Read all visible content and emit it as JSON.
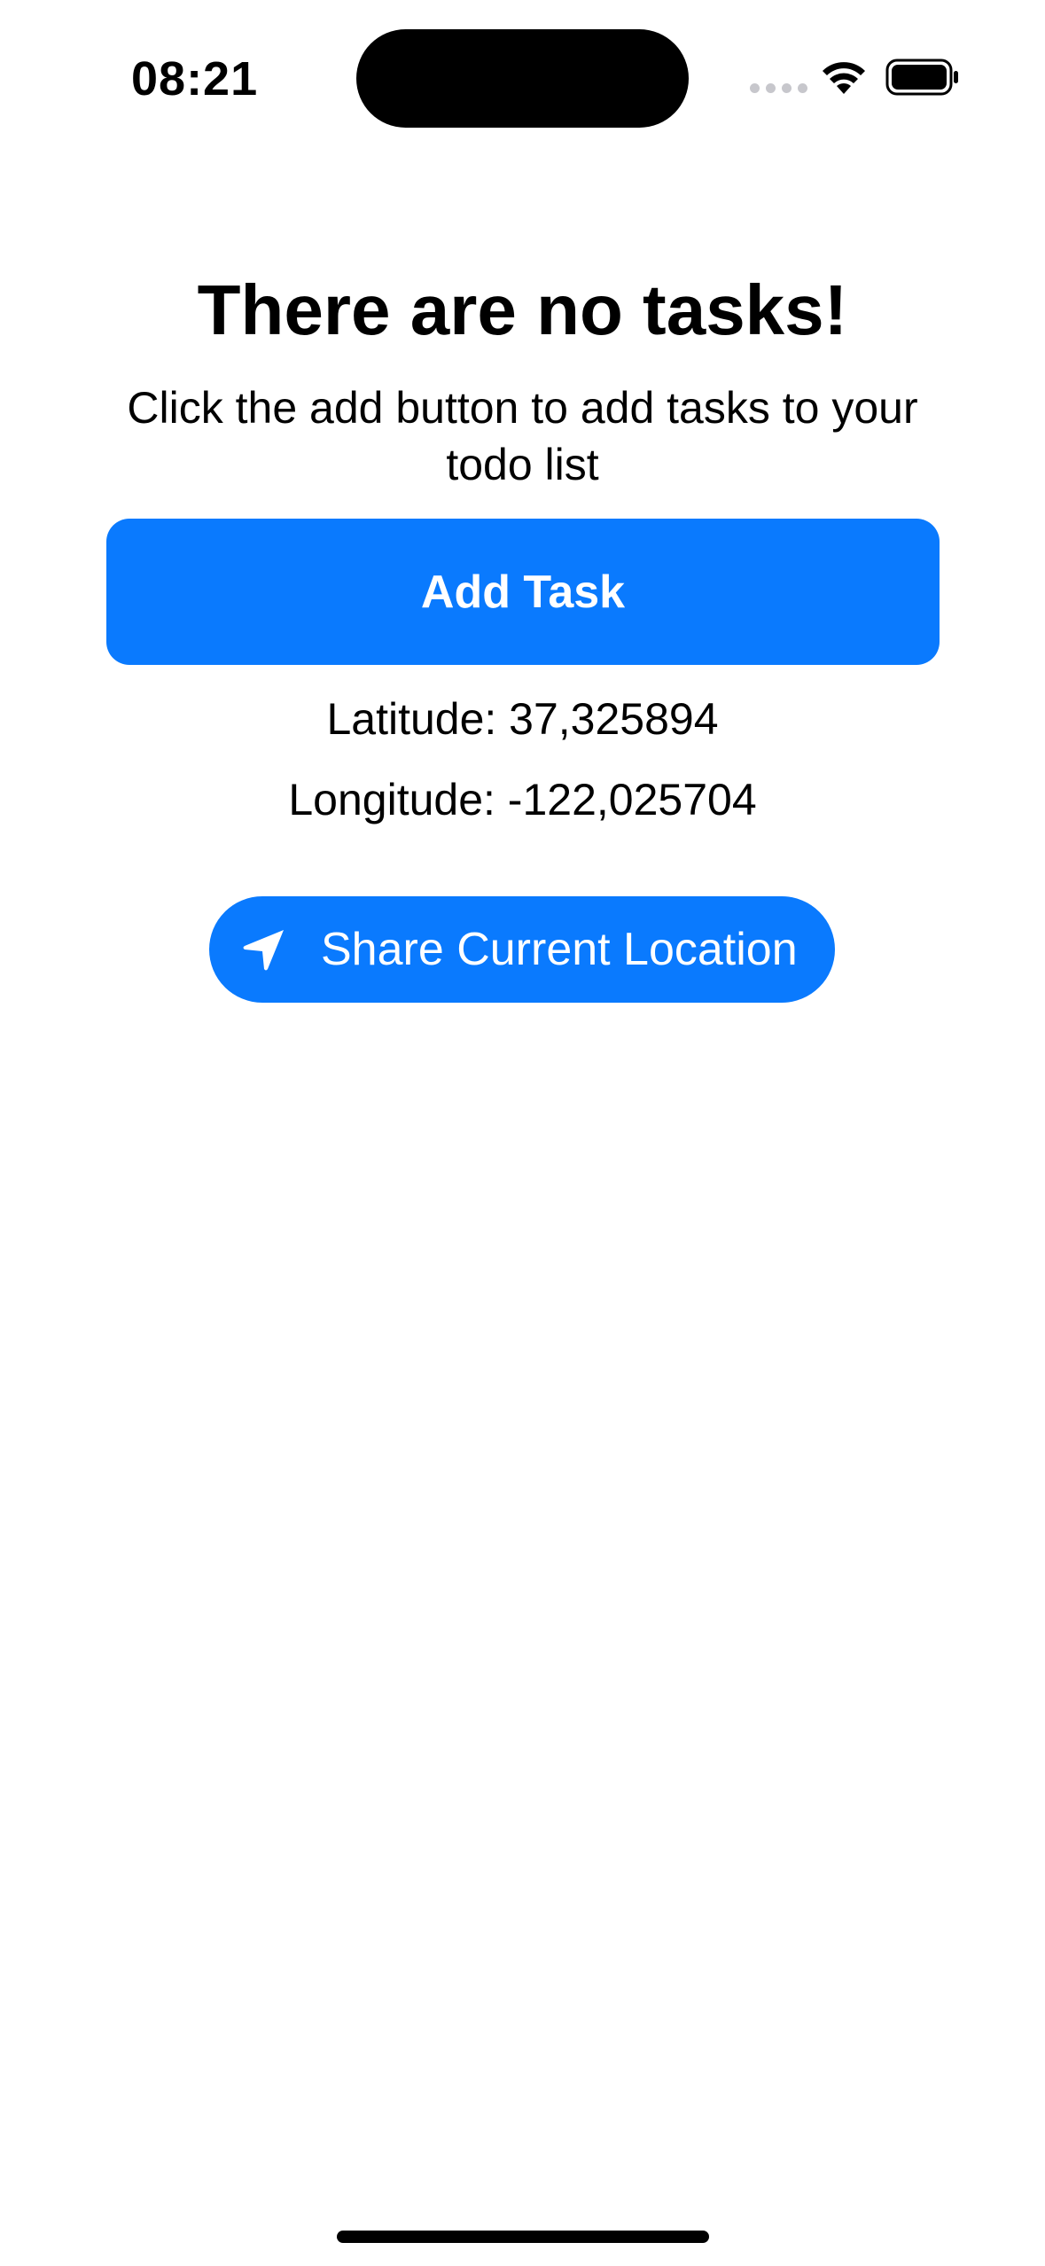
{
  "status_bar": {
    "time": "08:21",
    "icons": [
      "cellular-signal-icon",
      "wifi-icon",
      "battery-icon"
    ]
  },
  "empty_state": {
    "title": "There are no tasks!",
    "message": "Click the add button to add tasks to your todo list"
  },
  "add_task": {
    "label": "Add Task"
  },
  "location": {
    "latitude_text": "Latitude: 37,325894",
    "longitude_text": "Longitude: -122,025704"
  },
  "share_location": {
    "icon": "location-arrow-icon",
    "label": "Share Current Location"
  },
  "colors": {
    "accent": "#0A7AFE",
    "background": "#FFFFFF",
    "text": "#000000"
  }
}
